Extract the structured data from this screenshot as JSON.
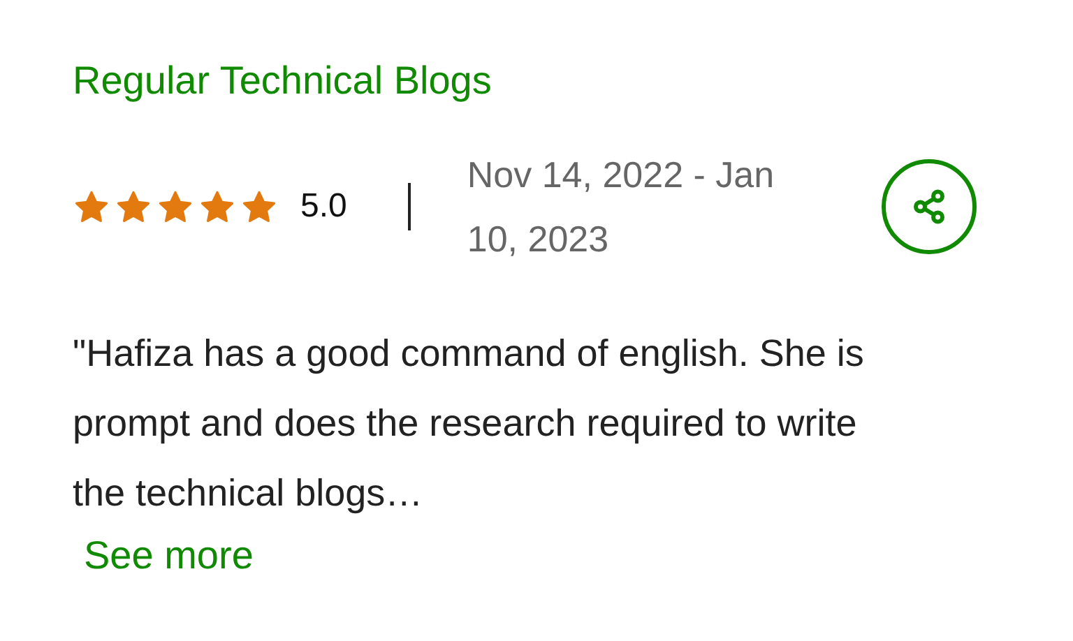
{
  "title": "Regular Technical Blogs",
  "rating": {
    "stars": 5,
    "score": "5.0"
  },
  "date_range": "Nov 14, 2022 - Jan 10, 2023",
  "review": "\"Hafiza has a good command of english. She is prompt and does the research required to write the technical blogs…",
  "see_more": "See more"
}
